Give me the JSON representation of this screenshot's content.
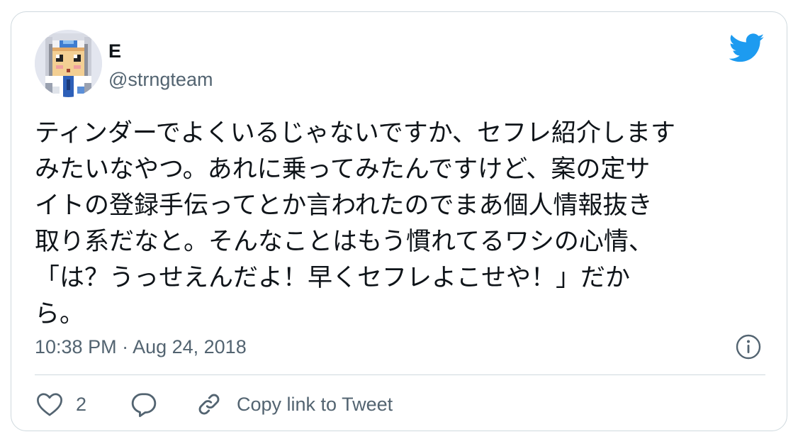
{
  "author": {
    "display_name": "E",
    "handle": "@strngteam",
    "avatar_icon": "pixel-art-avatar-icon"
  },
  "brand": {
    "icon": "twitter-bird-icon",
    "color": "#1d9bf0"
  },
  "tweet": {
    "text": "ティンダーでよくいるじゃないですか、セフレ紹介します\nみたいなやつ。あれに乗ってみたんですけど、案の定サ\nイトの登録手伝ってとか言われたのでまあ個人情報抜き\n取り系だなと。そんなことはもう慣れてるワシの心情、\n「は？うっせえんだよ！早くセフレよこせや！」だか\nら。",
    "timestamp": "10:38 PM · Aug 24, 2018"
  },
  "actions": {
    "like_icon": "heart-icon",
    "like_count": "2",
    "reply_icon": "speech-bubble-icon",
    "copy_icon": "link-icon",
    "copy_label": "Copy link to Tweet",
    "info_icon": "info-icon"
  },
  "colors": {
    "text_primary": "#0f1419",
    "text_secondary": "#536471",
    "border": "#cfd9de"
  }
}
